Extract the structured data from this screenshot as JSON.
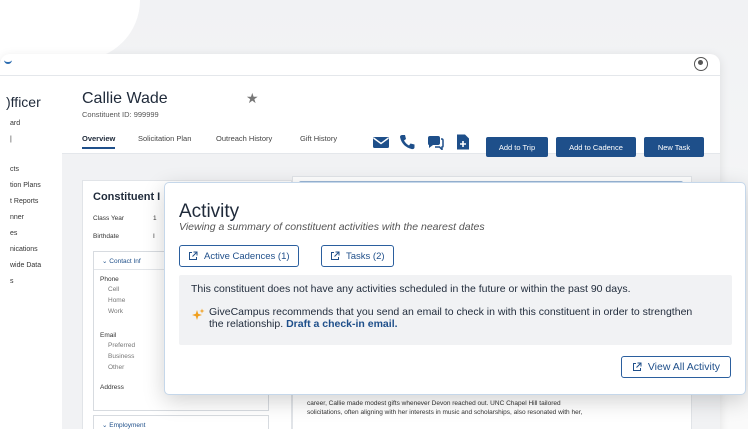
{
  "sidebar": {
    "title": ")fficer",
    "items": [
      "ard",
      "|",
      "cts",
      "tion Plans",
      "t Reports",
      "nner",
      "es",
      "nications",
      "wide Data",
      "s"
    ]
  },
  "header": {
    "name": "Callie Wade",
    "constituent_id": "Constituent ID: 999999",
    "tabs": [
      "Overview",
      "Solicitation Plan",
      "Outreach History",
      "Gift History"
    ],
    "buttons": [
      "Add to Trip",
      "Add to Cadence",
      "New Task"
    ]
  },
  "constituent_card": {
    "title": "Constituent I",
    "class_year_label": "Class Year",
    "class_year_value": "1",
    "birthdate_label": "Birthdate",
    "birthdate_value": "I",
    "contact_header": "Contact Inf",
    "phone_label": "Phone",
    "phone_types": [
      "Cell",
      "Home",
      "Work"
    ],
    "email_label": "Email",
    "email_types": [
      "Preferred",
      "Business",
      "Other"
    ],
    "address_label": "Address",
    "employment_header": "Employment"
  },
  "story": {
    "line1": "career, Callie made modest gifts whenever Devon reached out. UNC Chapel Hill tailored",
    "line2": "solicitations, often aligning with her interests in music and scholarships, also resonated with her,"
  },
  "activity": {
    "title": "Activity",
    "subtitle": "Viewing a summary of constituent activities with the nearest dates",
    "active_cadences": "Active Cadences (1)",
    "tasks": "Tasks (2)",
    "message": "This constituent does not have any activities scheduled in the future or within the past 90 days.",
    "recommendation": "GiveCampus recommends that you send an email to check in with this constituent in order to strengthen the relationship.",
    "link": "Draft a check-in email.",
    "view_all": "View All Activity"
  },
  "colors": {
    "primary": "#1e4f8a",
    "spark": "#f0a020"
  }
}
